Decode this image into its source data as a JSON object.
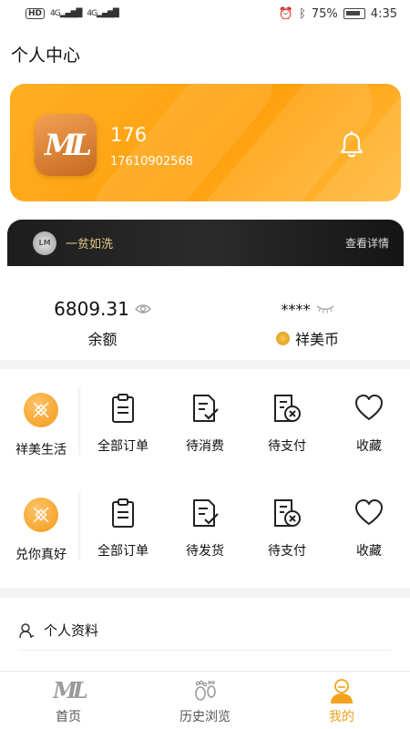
{
  "status_bar": {
    "hd": "HD",
    "network_1": "4G",
    "network_2": "4G",
    "battery_pct": "75%",
    "time": "4:35"
  },
  "header": {
    "title": "个人中心"
  },
  "profile": {
    "avatar_text": "ML",
    "name": "176",
    "phone": "17610902568"
  },
  "vip": {
    "badge_text": "LM",
    "level": "一贫如洗",
    "detail_link": "查看详情"
  },
  "wallet": {
    "balance_value": "6809.31",
    "balance_label": "余额",
    "coins_value": "****",
    "coins_label": "祥美币"
  },
  "menu_rows": [
    {
      "featured_label": "祥美生活",
      "items": [
        "全部订单",
        "待消费",
        "待支付",
        "收藏"
      ]
    },
    {
      "featured_label": "兑你真好",
      "items": [
        "全部订单",
        "待发货",
        "待支付",
        "收藏"
      ]
    }
  ],
  "list": {
    "profile_label": "个人资料"
  },
  "tabbar": {
    "logo_text": "ML",
    "home": "首页",
    "history": "历史浏览",
    "mine": "我的",
    "active_color": "#f2a21c"
  },
  "colors": {
    "accent": "#ffa614",
    "vip_gold": "#e8c98a"
  }
}
